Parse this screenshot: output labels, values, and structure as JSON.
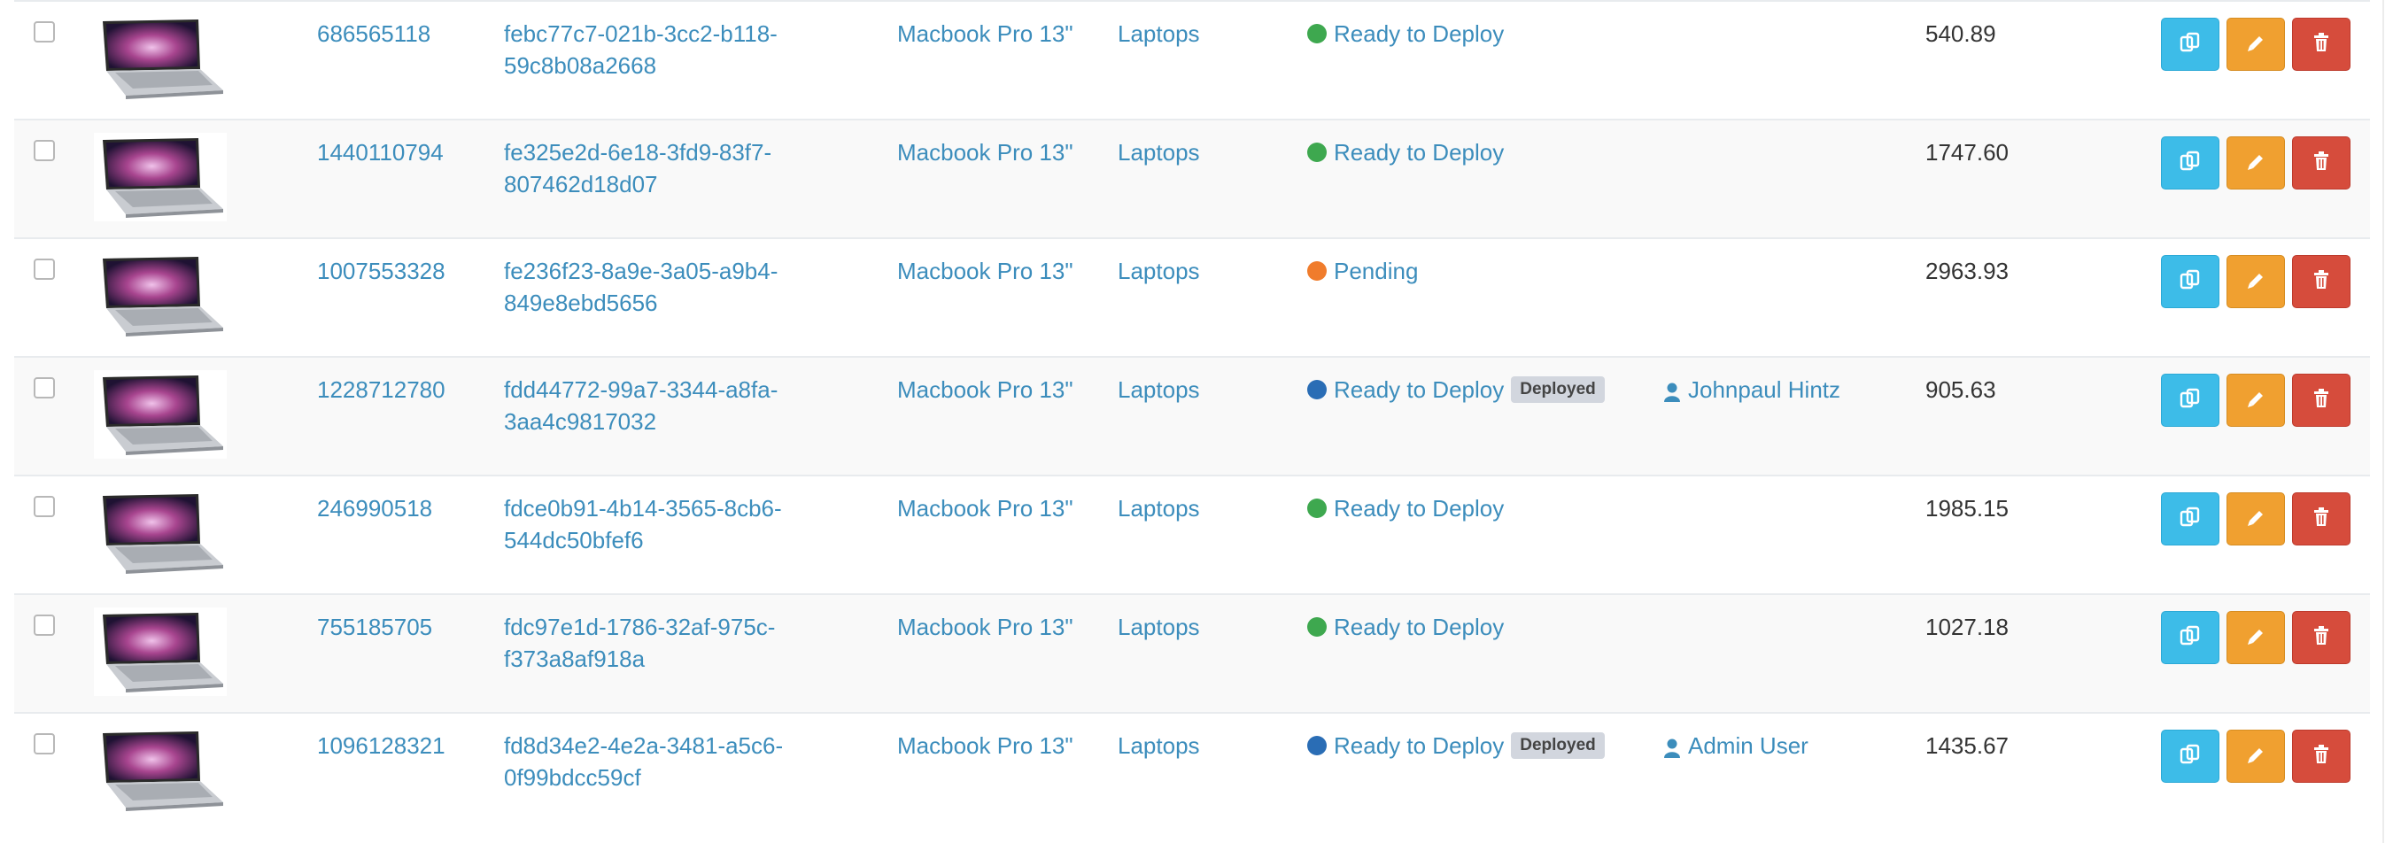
{
  "colors": {
    "link": "#3c8dbc",
    "ready_dot": "#3ea84f",
    "pending_dot": "#f07c2c",
    "deployed_dot": "#2a6db5",
    "clone_button": "#3dbce8",
    "edit_button": "#f0a030",
    "delete_button": "#d64c3c"
  },
  "rows": [
    {
      "asset_tag": "686565118",
      "serial_line1": "febc77c7-021b-3cc2-b118-",
      "serial_line2": "59c8b08a2668",
      "model": "Macbook Pro 13\"",
      "category": "Laptops",
      "status": "Ready to Deploy",
      "status_color": "green",
      "deployed_label": "",
      "assigned_to": "",
      "cost": "540.89",
      "thumb_icon": "laptop-image"
    },
    {
      "asset_tag": "1440110794",
      "serial_line1": "fe325e2d-6e18-3fd9-83f7-",
      "serial_line2": "807462d18d07",
      "model": "Macbook Pro 13\"",
      "category": "Laptops",
      "status": "Ready to Deploy",
      "status_color": "green",
      "deployed_label": "",
      "assigned_to": "",
      "cost": "1747.60",
      "thumb_icon": "laptop-image"
    },
    {
      "asset_tag": "1007553328",
      "serial_line1": "fe236f23-8a9e-3a05-a9b4-",
      "serial_line2": "849e8ebd5656",
      "model": "Macbook Pro 13\"",
      "category": "Laptops",
      "status": "Pending",
      "status_color": "orange",
      "deployed_label": "",
      "assigned_to": "",
      "cost": "2963.93",
      "thumb_icon": "laptop-image"
    },
    {
      "asset_tag": "1228712780",
      "serial_line1": "fdd44772-99a7-3344-a8fa-",
      "serial_line2": "3aa4c9817032",
      "model": "Macbook Pro 13\"",
      "category": "Laptops",
      "status": "Ready to Deploy",
      "status_color": "blue",
      "deployed_label": "Deployed",
      "assigned_to": "Johnpaul Hintz",
      "cost": "905.63",
      "thumb_icon": "laptop-image"
    },
    {
      "asset_tag": "246990518",
      "serial_line1": "fdce0b91-4b14-3565-8cb6-",
      "serial_line2": "544dc50bfef6",
      "model": "Macbook Pro 13\"",
      "category": "Laptops",
      "status": "Ready to Deploy",
      "status_color": "green",
      "deployed_label": "",
      "assigned_to": "",
      "cost": "1985.15",
      "thumb_icon": "laptop-image"
    },
    {
      "asset_tag": "755185705",
      "serial_line1": "fdc97e1d-1786-32af-975c-",
      "serial_line2": "f373a8af918a",
      "model": "Macbook Pro 13\"",
      "category": "Laptops",
      "status": "Ready to Deploy",
      "status_color": "green",
      "deployed_label": "",
      "assigned_to": "",
      "cost": "1027.18",
      "thumb_icon": "laptop-image"
    },
    {
      "asset_tag": "1096128321",
      "serial_line1": "fd8d34e2-4e2a-3481-a5c6-",
      "serial_line2": "0f99bdcc59cf",
      "model": "Macbook Pro 13\"",
      "category": "Laptops",
      "status": "Ready to Deploy",
      "status_color": "blue",
      "deployed_label": "Deployed",
      "assigned_to": "Admin User",
      "cost": "1435.67",
      "thumb_icon": "laptop-image"
    }
  ],
  "actions": {
    "clone_icon": "clone-icon",
    "edit_icon": "pencil-icon",
    "delete_icon": "trash-icon"
  }
}
